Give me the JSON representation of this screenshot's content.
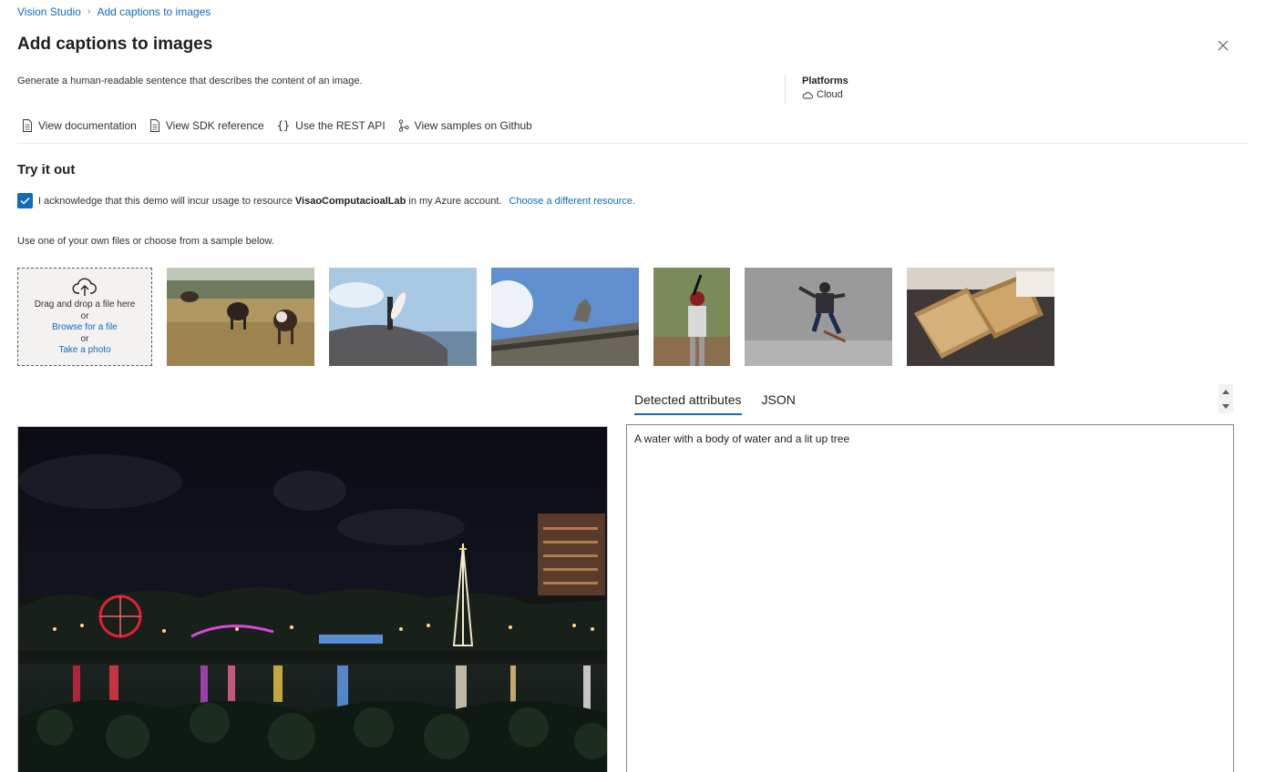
{
  "breadcrumb": {
    "root": "Vision Studio",
    "current": "Add captions to images"
  },
  "page": {
    "title": "Add captions to images",
    "description": "Generate a human-readable sentence that describes the content of an image."
  },
  "platforms": {
    "title": "Platforms",
    "value": "Cloud"
  },
  "links": {
    "documentation": "View documentation",
    "sdk": "View SDK reference",
    "rest": "Use the REST API",
    "github": "View samples on Github"
  },
  "tryit": {
    "title": "Try it out",
    "ack_prefix": "I acknowledge that this demo will incur usage to resource",
    "resource": "VisaoComputacioalLab",
    "ack_suffix": "in my Azure account.",
    "choose_resource": "Choose a different resource.",
    "acknowledged": true,
    "instructions": "Use one of your own files or choose from a sample below."
  },
  "upload": {
    "drag": "Drag and drop a file here",
    "or1": "or",
    "browse": "Browse for a file",
    "or2": "or",
    "photo": "Take a photo"
  },
  "results": {
    "tabs": [
      "Detected attributes",
      "JSON"
    ],
    "active_tab": "Detected attributes",
    "caption": "A water with a body of water and a lit up tree"
  },
  "colors": {
    "accent": "#0f6cbd",
    "text": "#323130"
  }
}
